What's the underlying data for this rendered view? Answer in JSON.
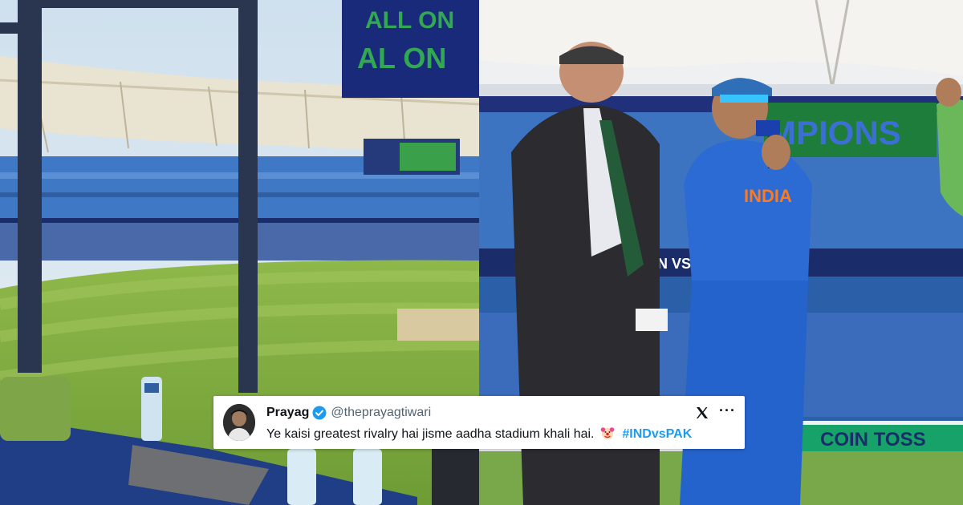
{
  "left_photo": {
    "description_icon": "stadium-view-photo",
    "screen_text_line1": "ALL ON",
    "screen_text_line2": "AL  ON"
  },
  "right_photo": {
    "description_icon": "coin-toss-photo",
    "banner_top": "MPIONS",
    "banner_coin_toss": "COIN TOSS",
    "jersey_text": "INDIA",
    "board_text": "N VS IN"
  },
  "tweet": {
    "display_name": "Prayag",
    "handle": "@theprayagtiwari",
    "text": "Ye kaisi greatest rivalry hai jisme aadha stadium khali hai.",
    "emoji": "clown-face",
    "hashtag": "#INDvsPAK",
    "more": "···",
    "colors": {
      "accent": "#1d9bf0",
      "text": "#0f1419",
      "muted": "#536471"
    }
  }
}
